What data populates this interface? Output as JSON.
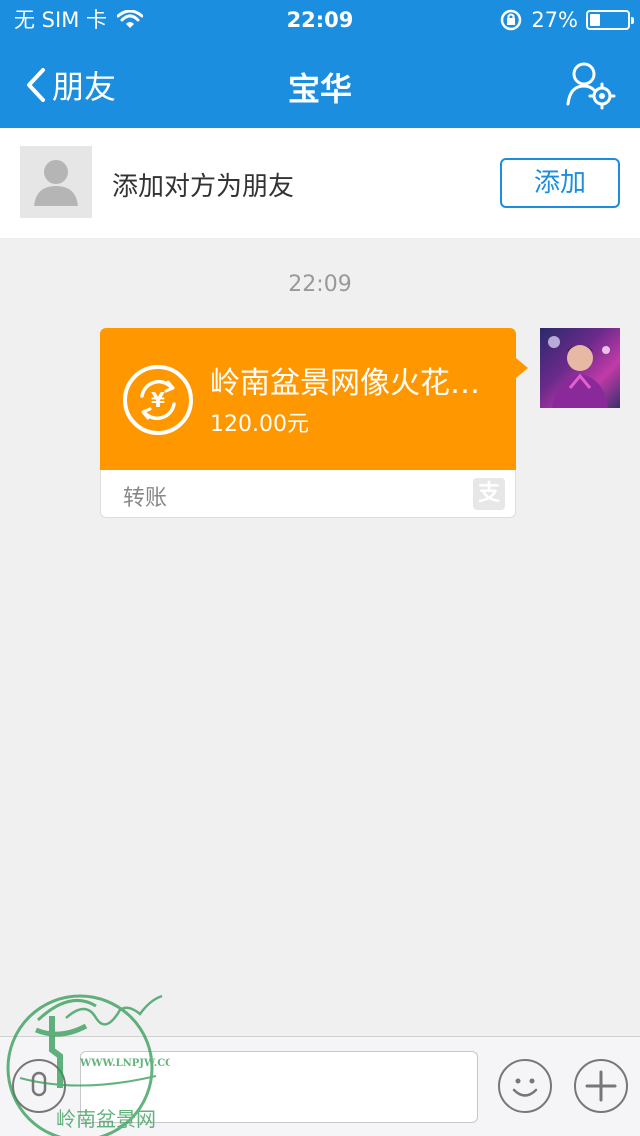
{
  "status_bar": {
    "carrier": "无 SIM 卡",
    "time": "22:09",
    "battery_percent": "27%",
    "battery_level": 0.27,
    "icons": [
      "wifi-icon",
      "rotation-lock-icon",
      "battery-icon"
    ]
  },
  "nav": {
    "back_label": "朋友",
    "title": "宝华",
    "settings_icon": "user-settings-icon"
  },
  "add_friend": {
    "text": "添加对方为朋友",
    "button_label": "添加"
  },
  "chat": {
    "timestamp": "22:09",
    "transfer": {
      "title": "岭南盆景网像火花…",
      "amount": "120.00元",
      "footer_label": "转账",
      "footer_icon_text": "支",
      "card_color": "#ff9800"
    }
  },
  "input_bar": {
    "icons": [
      "voice-icon",
      "emoji-icon",
      "plus-icon"
    ]
  },
  "watermark": {
    "url_text": "WWW.LNPJW.COM",
    "name_text": "岭南盆景网"
  },
  "colors": {
    "brand": "#1b8ee0",
    "accent": "#ff9800",
    "background": "#f0f0f0"
  }
}
